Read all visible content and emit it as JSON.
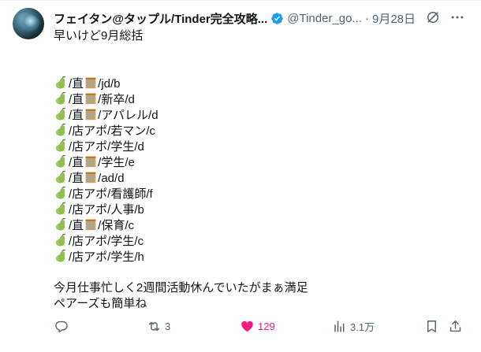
{
  "tweet": {
    "display_name": "フェイタン@タップル/Tinder完全攻略...",
    "handle": "@Tinder_go...",
    "separator": "·",
    "date": "9月28日",
    "intro": "早いけど9月総括",
    "entries": [
      {
        "pre": "/直",
        "building": true,
        "post": "/jd/b"
      },
      {
        "pre": "/直",
        "building": true,
        "post": "/新卒/d"
      },
      {
        "pre": "/直",
        "building": true,
        "post": "/アパレル/d"
      },
      {
        "pre": "/店アポ/若マン/c",
        "building": false,
        "post": ""
      },
      {
        "pre": "/店アポ/学生/d",
        "building": false,
        "post": ""
      },
      {
        "pre": "/直",
        "building": true,
        "post": "/学生/e"
      },
      {
        "pre": "/直",
        "building": true,
        "post": "/ad/d"
      },
      {
        "pre": "/店アポ/看護師/f",
        "building": false,
        "post": ""
      },
      {
        "pre": "/店アポ/人事/b",
        "building": false,
        "post": ""
      },
      {
        "pre": "/直",
        "building": true,
        "post": "/保育/c"
      },
      {
        "pre": "/店アポ/学生/c",
        "building": false,
        "post": ""
      },
      {
        "pre": "/店アポ/学生/h",
        "building": false,
        "post": ""
      }
    ],
    "outro_1": "今月仕事忙しく2週間活動休んでいたがまぁ満足",
    "outro_2": "ペアーズも簡単ね"
  },
  "actions": {
    "reply_count": "",
    "retweet_count": "3",
    "like_count": "129",
    "views_count": "3.1万"
  },
  "icons": {
    "verified": "verified-badge-icon",
    "grok": "grok-icon",
    "more": "more-icon",
    "leaf": "pear-emoji",
    "building": "hotel-emoji",
    "reply": "reply-icon",
    "retweet": "retweet-icon",
    "like": "heart-icon",
    "views": "views-icon",
    "bookmark": "bookmark-icon",
    "share": "share-icon"
  },
  "colors": {
    "text": "#0f1419",
    "secondary": "#536471",
    "verified": "#1d9bf0",
    "like": "#f91880"
  }
}
